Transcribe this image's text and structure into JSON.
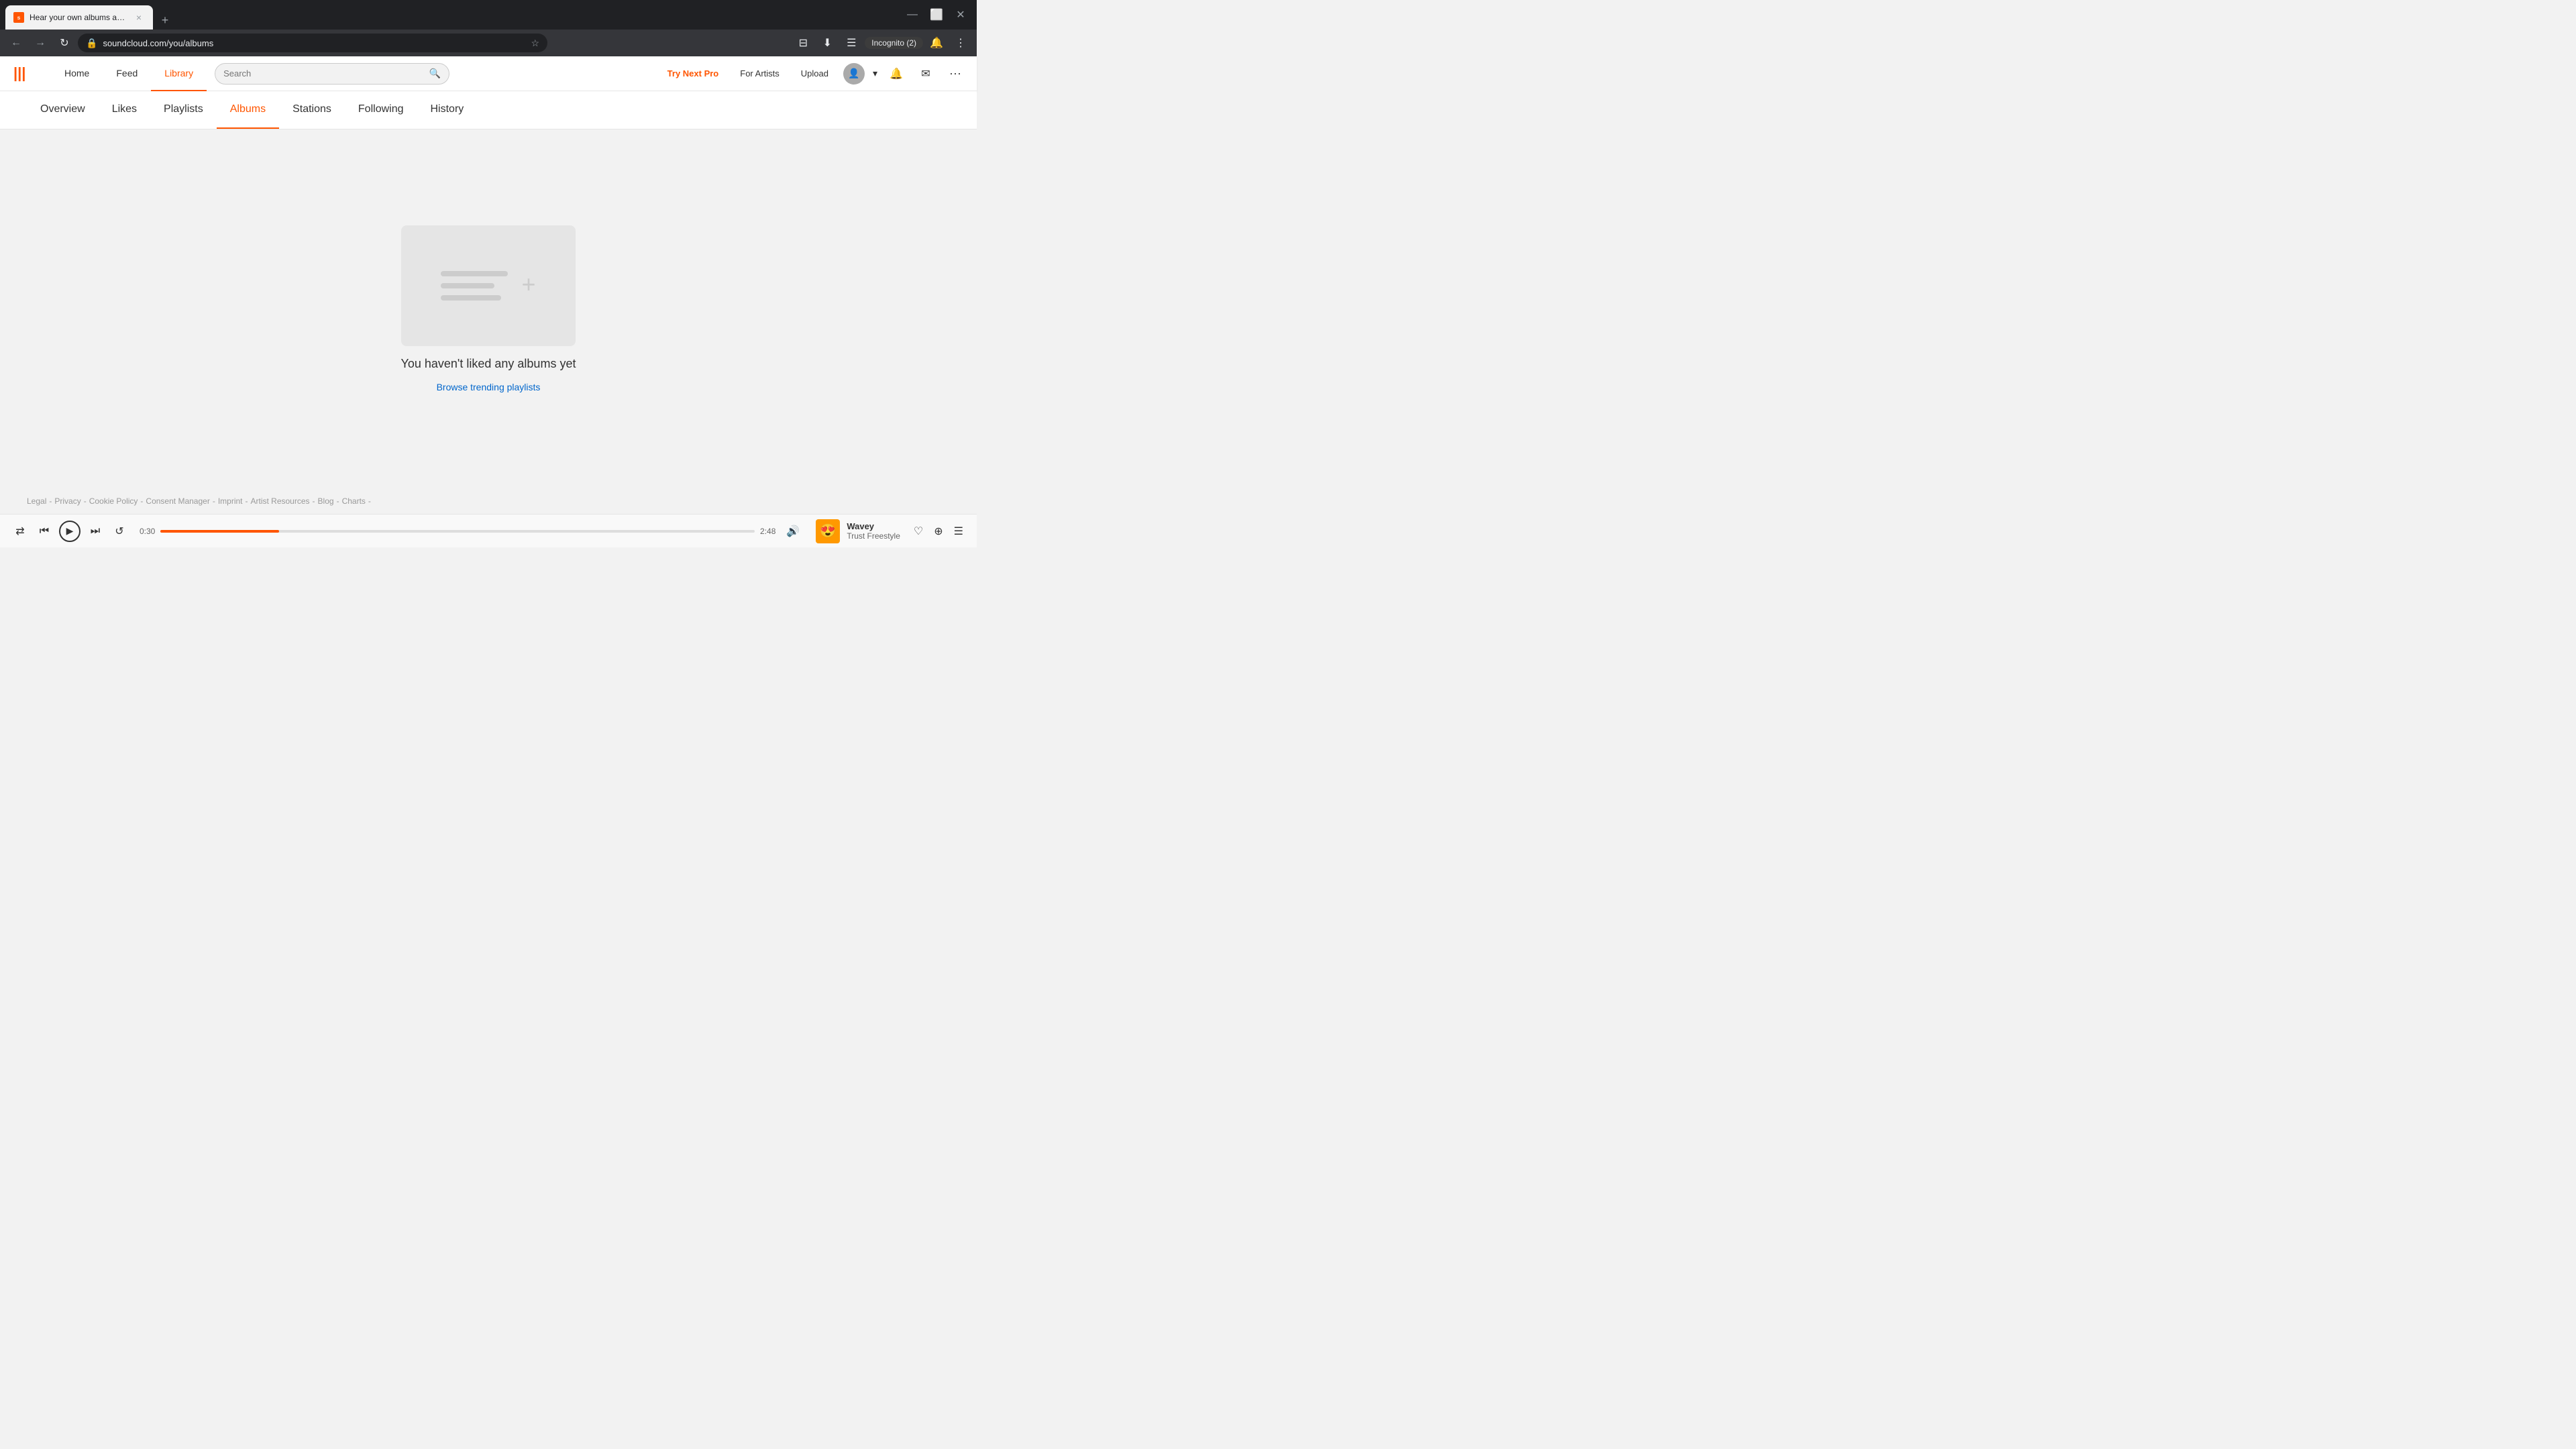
{
  "browser": {
    "tab_title": "Hear your own albums and the",
    "tab_favicon": "SC",
    "url": "soundcloud.com/you/albums",
    "new_tab_label": "+",
    "close_label": "×",
    "incognito_label": "Incognito (2)"
  },
  "header": {
    "logo_alt": "SoundCloud",
    "nav": {
      "home": "Home",
      "feed": "Feed",
      "library": "Library"
    },
    "search_placeholder": "Search",
    "try_pro": "Try Next Pro",
    "for_artists": "For Artists",
    "upload": "Upload"
  },
  "sub_nav": {
    "items": [
      {
        "id": "overview",
        "label": "Overview",
        "active": false
      },
      {
        "id": "likes",
        "label": "Likes",
        "active": false
      },
      {
        "id": "playlists",
        "label": "Playlists",
        "active": false
      },
      {
        "id": "albums",
        "label": "Albums",
        "active": true
      },
      {
        "id": "stations",
        "label": "Stations",
        "active": false
      },
      {
        "id": "following",
        "label": "Following",
        "active": false
      },
      {
        "id": "history",
        "label": "History",
        "active": false
      }
    ]
  },
  "main": {
    "empty_title": "You haven't liked any albums yet",
    "browse_link": "Browse trending playlists"
  },
  "footer": {
    "items": [
      "Legal",
      "-",
      "Privacy",
      "-",
      "Cookie Policy",
      "-",
      "Consent Manager",
      "-",
      "Imprint",
      "-",
      "Artist Resources",
      "-",
      "Blog",
      "-",
      "Charts",
      "-"
    ]
  },
  "player": {
    "current_time": "0:30",
    "total_time": "2:48",
    "track_title": "Wavey",
    "track_artist": "Trust Freestyle",
    "artwork_emoji": "😍",
    "progress_percent": 20
  }
}
